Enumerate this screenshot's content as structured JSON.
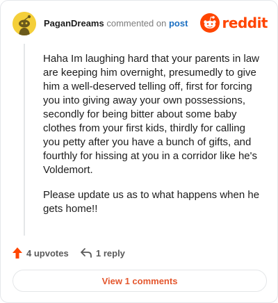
{
  "header": {
    "username": "PaganDreams",
    "action_text": "commented on",
    "post_link": "post",
    "brand_name": "reddit"
  },
  "comment": {
    "paragraphs": [
      "Haha Im laughing hard that your parents in law are keeping him overnight, presumedly to give him a well-deserved telling off, first for forcing you into giving away your own possessions, secondly for being bitter about some baby clothes from your first kids, thirdly for calling you petty after you have a bunch of gifts, and fourthly for hissing at you in a corridor like he's Voldemort.",
      "Please update us as to what happens when he gets home!!"
    ]
  },
  "actions": {
    "upvotes_label": "4 upvotes",
    "reply_label": "1 reply"
  },
  "footer": {
    "view_comments_label": "View 1 comments"
  },
  "colors": {
    "accent": "#ff4500",
    "link": "#1b6fc2",
    "avatar_bg": "#f4cf3a"
  },
  "icons": [
    "avatar-snoo-icon",
    "reddit-logo-icon",
    "upvote-arrow-icon",
    "reply-arrow-icon"
  ]
}
